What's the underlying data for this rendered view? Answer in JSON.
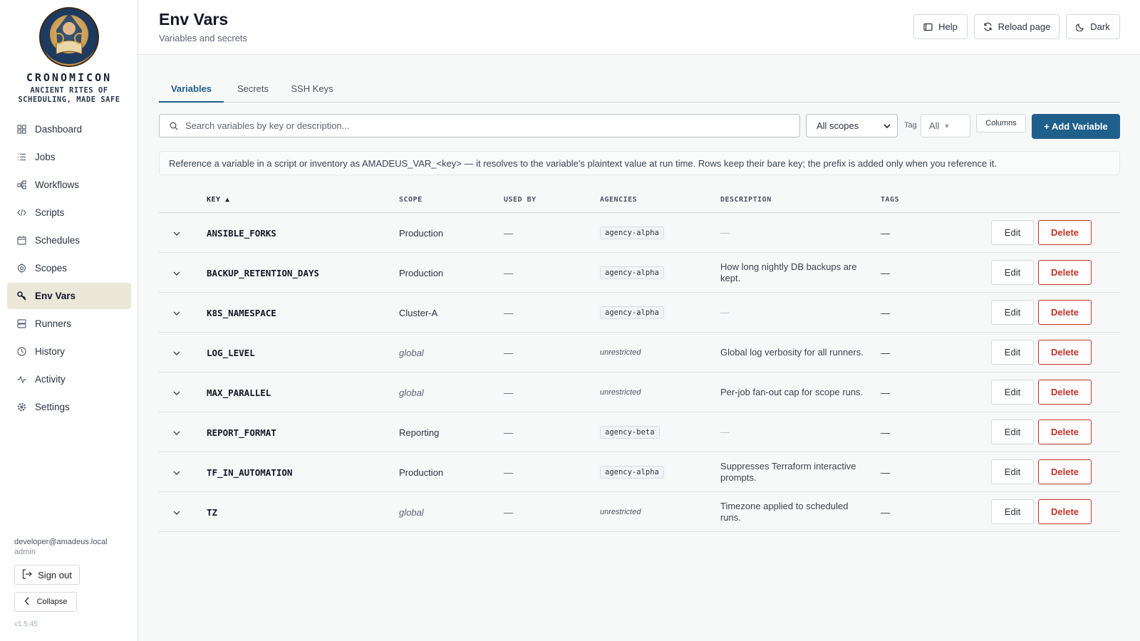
{
  "brand": {
    "name": "CRONOMICON",
    "tagline": "ANCIENT RITES OF SCHEDULING, MADE SAFE"
  },
  "sidebar": {
    "items": [
      {
        "label": "Dashboard",
        "icon": "grid-icon"
      },
      {
        "label": "Jobs",
        "icon": "list-icon"
      },
      {
        "label": "Workflows",
        "icon": "workflow-icon"
      },
      {
        "label": "Scripts",
        "icon": "code-icon"
      },
      {
        "label": "Schedules",
        "icon": "calendar-icon"
      },
      {
        "label": "Scopes",
        "icon": "target-icon"
      },
      {
        "label": "Env Vars",
        "icon": "key-icon",
        "active": true
      },
      {
        "label": "Runners",
        "icon": "server-icon"
      },
      {
        "label": "History",
        "icon": "clock-icon"
      },
      {
        "label": "Activity",
        "icon": "pulse-icon"
      },
      {
        "label": "Settings",
        "icon": "gear-icon"
      }
    ],
    "user_email": "developer@amadeus.local",
    "user_role": "admin",
    "signout_label": "Sign out",
    "collapse_label": "Collapse",
    "version": "v1.5.45"
  },
  "header": {
    "title": "Env Vars",
    "subtitle": "Variables and secrets",
    "help_label": "Help",
    "reload_label": "Reload page",
    "theme_label": "Dark"
  },
  "tabs": [
    {
      "label": "Variables",
      "active": true
    },
    {
      "label": "Secrets"
    },
    {
      "label": "SSH Keys"
    }
  ],
  "toolbar": {
    "search_placeholder": "Search variables by key or description...",
    "scope_value": "All scopes",
    "tag_label": "Tag",
    "tag_value": "All",
    "columns_label": "Columns",
    "add_label": "+ Add Variable"
  },
  "info_text": "Reference a variable in a script or inventory as AMADEUS_VAR_<key> — it resolves to the variable's plaintext value at run time. Rows keep their bare key; the prefix is added only when you reference it.",
  "table": {
    "columns": {
      "key": "KEY ▲",
      "scope": "SCOPE",
      "used_by": "USED BY",
      "agencies": "AGENCIES",
      "description": "DESCRIPTION",
      "tags": "TAGS"
    },
    "edit_label": "Edit",
    "delete_label": "Delete",
    "rows": [
      {
        "key": "ANSIBLE_FORKS",
        "scope": "Production",
        "used_by": "—",
        "agency": "agency-alpha",
        "description": "—",
        "tags": "—"
      },
      {
        "key": "BACKUP_RETENTION_DAYS",
        "scope": "Production",
        "used_by": "—",
        "agency": "agency-alpha",
        "description": "How long nightly DB backups are kept.",
        "tags": "—"
      },
      {
        "key": "K8S_NAMESPACE",
        "scope": "Cluster-A",
        "used_by": "—",
        "agency": "agency-alpha",
        "description": "—",
        "tags": "—"
      },
      {
        "key": "LOG_LEVEL",
        "scope": "global",
        "used_by": "—",
        "agency": "unrestricted",
        "description": "Global log verbosity for all runners.",
        "tags": "—"
      },
      {
        "key": "MAX_PARALLEL",
        "scope": "global",
        "used_by": "—",
        "agency": "unrestricted",
        "description": "Per-job fan-out cap for scope runs.",
        "tags": "—"
      },
      {
        "key": "REPORT_FORMAT",
        "scope": "Reporting",
        "used_by": "—",
        "agency": "agency-beta",
        "description": "—",
        "tags": "—"
      },
      {
        "key": "TF_IN_AUTOMATION",
        "scope": "Production",
        "used_by": "—",
        "agency": "agency-alpha",
        "description": "Suppresses Terraform interactive prompts.",
        "tags": "—"
      },
      {
        "key": "TZ",
        "scope": "global",
        "used_by": "—",
        "agency": "unrestricted",
        "description": "Timezone applied to scheduled runs.",
        "tags": "—"
      }
    ]
  }
}
